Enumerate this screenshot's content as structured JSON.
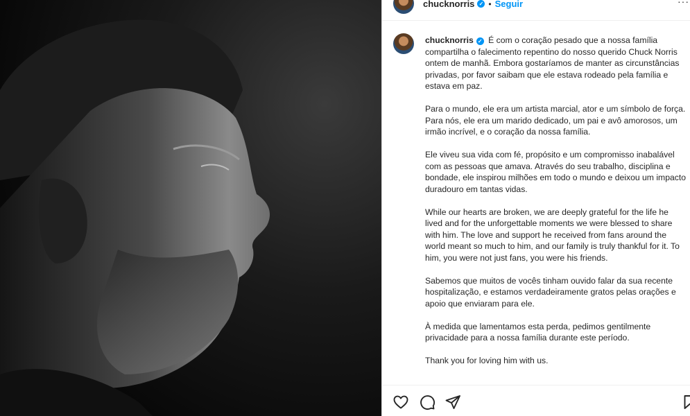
{
  "post": {
    "username": "chucknorris",
    "verified": true,
    "separator": "•",
    "follow_label": "Seguir",
    "more_label": "···"
  },
  "caption": {
    "username": "chucknorris",
    "paragraphs": [
      "É com o coração pesado que a nossa família compartilha o falecimento repentino do nosso querido Chuck Norris ontem de manhã. Embora gostaríamos de manter as circunstâncias privadas, por favor saibam que ele estava rodeado pela família e estava em paz.",
      "Para o mundo, ele era um artista marcial, ator e um símbolo de força. Para nós, ele era um marido dedicado, um pai e avô amorosos, um irmão incrível, e o coração da nossa família.",
      "Ele viveu sua vida com fé, propósito e um compromisso inabalável com as pessoas que amava. Através do seu trabalho, disciplina e bondade, ele inspirou milhões em todo o mundo e deixou um impacto duradouro em tantas vidas.",
      "While our hearts are broken, we are deeply grateful for the life he lived and for the unforgettable moments we were blessed to share with him. The love and support he received from fans around the world meant so much to him, and our family is truly thankful for it. To him, you were not just fans, you were his friends.",
      "Sabemos que muitos de vocês tinham ouvido falar da sua recente hospitalização, e estamos verdadeiramente gratos pelas orações e apoio que enviaram para ele.",
      "À medida que lamentamos esta perda, pedimos gentilmente privacidade para a nossa família durante este período.",
      "Thank you for loving him with us."
    ]
  },
  "actions": {
    "icons": [
      "heart-icon",
      "comment-icon",
      "share-icon",
      "bookmark-icon"
    ]
  },
  "colors": {
    "accent": "#0095f6",
    "text": "#262626",
    "border": "#dbdbdb"
  }
}
